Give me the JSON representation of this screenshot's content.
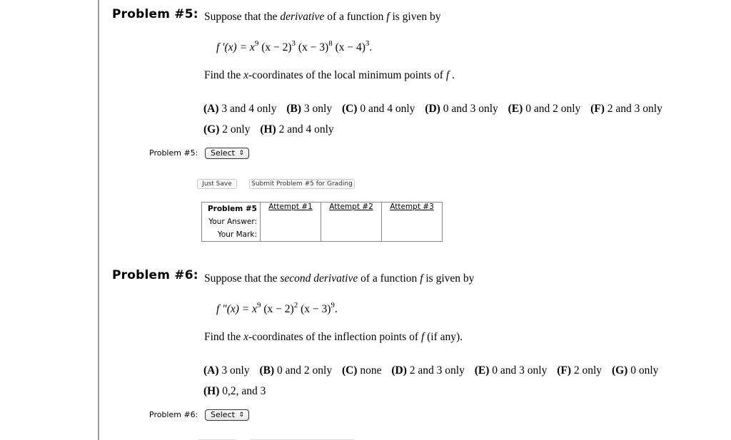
{
  "problems": [
    {
      "title": "Problem #5:",
      "intro_pre": "Suppose that the ",
      "intro_em": "derivative",
      "intro_post": " of a function ",
      "intro_f": "f",
      "intro_end": " is given by",
      "formula": {
        "lhs": "f '(x) = ",
        "parts": [
          {
            "base": "x",
            "exp": "9"
          },
          {
            "base": " (x − 2)",
            "exp": "3"
          },
          {
            "base": " (x − 3)",
            "exp": "8"
          },
          {
            "base": " (x − 4)",
            "exp": "3"
          }
        ],
        "end": "."
      },
      "question_pre": "Find the ",
      "question_x": "x",
      "question_mid": "-coordinates of the local minimum points of ",
      "question_f": "f",
      "question_end": " .",
      "choices_line1": [
        {
          "key": "(A)",
          "text": " 3 and 4 only"
        },
        {
          "key": "(B)",
          "text": " 3 only"
        },
        {
          "key": "(C)",
          "text": " 0 and 4 only"
        },
        {
          "key": "(D)",
          "text": " 0 and 3 only"
        },
        {
          "key": "(E)",
          "text": " 0 and 2 only"
        },
        {
          "key": "(F)",
          "text": " 2 and 3 only"
        }
      ],
      "choices_line2": [
        {
          "key": "(G)",
          "text": " 2 only"
        },
        {
          "key": "(H)",
          "text": " 2 and 4 only"
        }
      ],
      "select_label": "Problem #5:",
      "select_value": "Select",
      "just_save": "Just Save",
      "submit": "Submit Problem #5 for Grading",
      "table": {
        "header": "Problem #5",
        "attempts": [
          "Attempt #1",
          "Attempt #2",
          "Attempt #3"
        ],
        "row_answer": "Your Answer:",
        "row_mark": "Your Mark:"
      }
    },
    {
      "title": "Problem #6:",
      "intro_pre": "Suppose that the ",
      "intro_em": "second derivative",
      "intro_post": " of a function ",
      "intro_f": "f",
      "intro_end": " is given by",
      "formula": {
        "lhs": "f \"(x) = ",
        "parts": [
          {
            "base": "x",
            "exp": "9"
          },
          {
            "base": " (x − 2)",
            "exp": "2"
          },
          {
            "base": " (x − 3)",
            "exp": "9"
          }
        ],
        "end": "."
      },
      "question_pre": "Find the ",
      "question_x": "x",
      "question_mid": "-coordinates of the inflection points of ",
      "question_f": "f",
      "question_end": " (if any).",
      "choices_line1": [
        {
          "key": "(A)",
          "text": " 3 only"
        },
        {
          "key": "(B)",
          "text": " 0 and 2 only"
        },
        {
          "key": "(C)",
          "text": " none"
        },
        {
          "key": "(D)",
          "text": " 2 and 3 only"
        },
        {
          "key": "(E)",
          "text": " 0 and 3 only"
        },
        {
          "key": "(F)",
          "text": " 2 only"
        },
        {
          "key": "(G)",
          "text": " 0 only"
        }
      ],
      "choices_line2": [
        {
          "key": "(H)",
          "text": " 0,2, and 3"
        }
      ],
      "select_label": "Problem #6:",
      "select_value": "Select"
    }
  ],
  "icons": {
    "select_arrows": "⇕"
  }
}
